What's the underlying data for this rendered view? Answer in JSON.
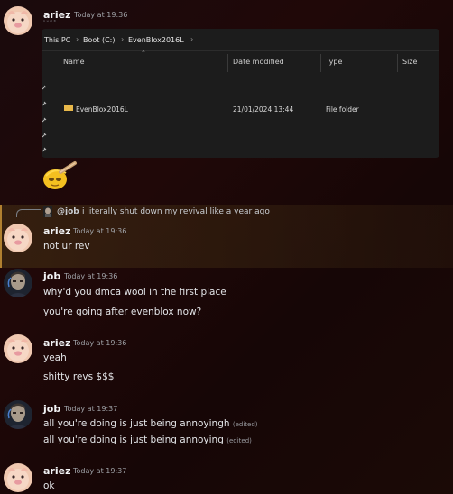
{
  "messages": [
    {
      "author": "ariez",
      "timestamp": "Today at 19:36",
      "truncated_line": "ⁿ ᵘ ᵘˡ ˡᵗ"
    },
    {
      "reply": {
        "author": "@job",
        "text": "i literally shut down my revival like a year ago"
      }
    },
    {
      "author": "ariez",
      "timestamp": "Today at 19:36",
      "lines": [
        "not ur rev"
      ]
    },
    {
      "author": "job",
      "timestamp": "Today at 19:36",
      "lines": [
        "why'd you dmca wool in the first place",
        "you're going after evenblox now?"
      ]
    },
    {
      "author": "ariez",
      "timestamp": "Today at 19:36",
      "lines": [
        "yeah",
        "shitty revs $$$"
      ]
    },
    {
      "author": "job",
      "timestamp": "Today at 19:37",
      "lines": [
        "all you're doing is just being annoyingh",
        "all you're doing is just being annoying"
      ],
      "edited_label": "(edited)"
    },
    {
      "author": "ariez",
      "timestamp": "Today at 19:37",
      "lines": [
        "ok"
      ]
    }
  ],
  "explorer": {
    "breadcrumb": [
      "This PC",
      "Boot (C:)",
      "EvenBlox2016L"
    ],
    "separator": "›",
    "columns": [
      "Name",
      "Date modified",
      "Type",
      "Size"
    ],
    "rows": [
      {
        "name": "EvenBlox2016L",
        "modified": "21/01/2024 13:44",
        "type": "File folder",
        "size": ""
      }
    ]
  },
  "colors": {
    "accent_reply": "#b08030",
    "folder": "#e8b84a",
    "username": "#f2f3f5"
  }
}
